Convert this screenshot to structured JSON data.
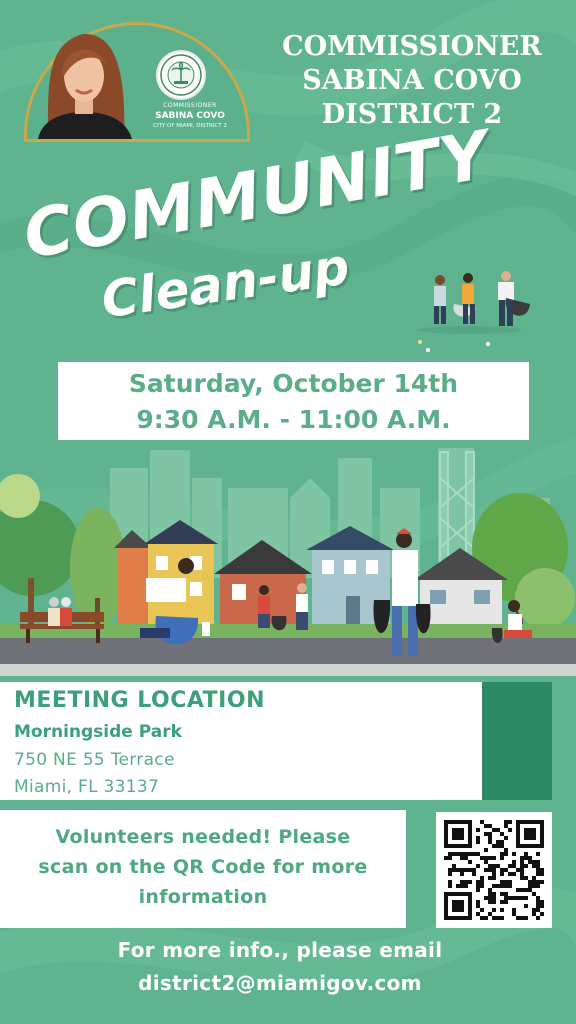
{
  "colors": {
    "background": "#5fb48f",
    "accent_dark": "#2b8a63",
    "text_green": "#5aad87",
    "badge_gold": "#c9a949",
    "white": "#ffffff"
  },
  "badge": {
    "role": "COMMISSIONER",
    "name": "SABINA COVO",
    "city": "CITY OF MIAMI, DISTRICT 2",
    "portrait_icon": "portrait-photo",
    "seal_icon": "city-seal-icon"
  },
  "header": {
    "line1": "COMMISSIONER",
    "line2": "SABINA COVO",
    "line3": "DISTRICT 2"
  },
  "title": {
    "line1": "COMMUNITY",
    "line2": "Clean-up"
  },
  "event": {
    "date": "Saturday, October 14th",
    "time": "9:30 A.M. - 11:00 A.M."
  },
  "location": {
    "heading": "MEETING LOCATION",
    "park": "Morningside Park",
    "street": "750 NE 55 Terrace",
    "city": "Miami, FL 33137"
  },
  "volunteers": {
    "line1": "Volunteers needed! Please",
    "line2": "scan on the QR Code for more",
    "line3": "information",
    "qr_icon": "qr-code-icon"
  },
  "footer": {
    "line1": "For more info., please email",
    "line2": "district2@miamigov.com"
  }
}
